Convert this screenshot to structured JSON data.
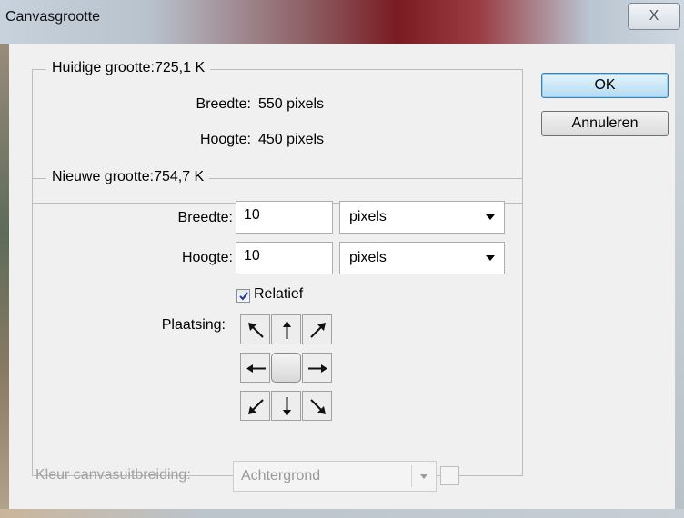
{
  "window": {
    "title": "Canvasgrootte",
    "close_glyph": "X"
  },
  "current": {
    "legend": "Huidige grootte:725,1 K",
    "width_label": "Breedte:",
    "width_value": "550 pixels",
    "height_label": "Hoogte:",
    "height_value": "450 pixels"
  },
  "new": {
    "legend": "Nieuwe grootte:754,7 K",
    "width_label": "Breedte:",
    "width_value": "10",
    "width_unit": "pixels",
    "height_label": "Hoogte:",
    "height_value": "10",
    "height_unit": "pixels",
    "relative_label": "Relatief",
    "relative_checked": true,
    "anchor_label": "Plaatsing:",
    "anchor_icons": [
      "arrow-up-left-icon",
      "arrow-up-icon",
      "arrow-up-right-icon",
      "arrow-left-icon",
      "anchor-center",
      "arrow-right-icon",
      "arrow-down-left-icon",
      "arrow-down-icon",
      "arrow-down-right-icon"
    ]
  },
  "buttons": {
    "ok": "OK",
    "cancel": "Annuleren"
  },
  "extension": {
    "label": "Kleur canvasuitbreiding:",
    "value": "Achtergrond"
  }
}
